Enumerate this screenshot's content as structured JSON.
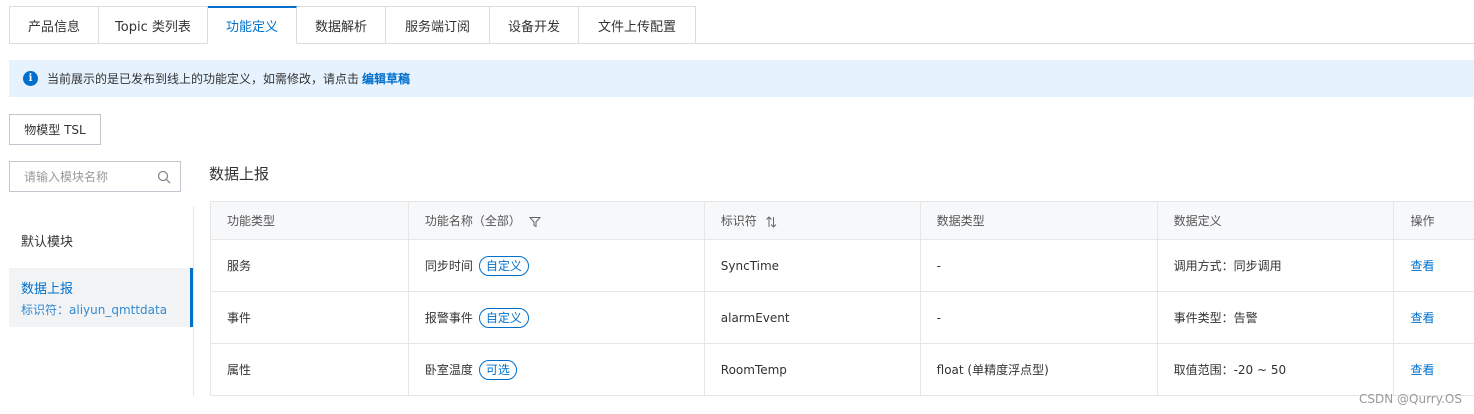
{
  "tabs": [
    {
      "label": "产品信息"
    },
    {
      "label": "Topic 类列表"
    },
    {
      "label": "功能定义",
      "active": true
    },
    {
      "label": "数据解析"
    },
    {
      "label": "服务端订阅"
    },
    {
      "label": "设备开发"
    },
    {
      "label": "文件上传配置"
    }
  ],
  "notice": {
    "text": "当前展示的是已发布到线上的功能定义，如需修改，请点击",
    "link": "编辑草稿"
  },
  "tsl_button": "物模型 TSL",
  "search": {
    "placeholder": "请输入模块名称"
  },
  "modules": [
    {
      "name": "默认模块"
    },
    {
      "name": "数据上报",
      "id_text": "标识符：aliyun_qmttdata"
    }
  ],
  "section_title": "数据上报",
  "table": {
    "headers": [
      "功能类型",
      "功能名称（全部）",
      "标识符",
      "数据类型",
      "数据定义",
      "操作"
    ],
    "rows": [
      {
        "type": "服务",
        "name": "同步时间",
        "tag": "自定义",
        "identifier": "SyncTime",
        "data_type": "-",
        "definition": "调用方式：同步调用",
        "action": "查看"
      },
      {
        "type": "事件",
        "name": "报警事件",
        "tag": "自定义",
        "identifier": "alarmEvent",
        "data_type": "-",
        "definition": "事件类型：告警",
        "action": "查看"
      },
      {
        "type": "属性",
        "name": "卧室温度",
        "tag": "可选",
        "identifier": "RoomTemp",
        "data_type": "float (单精度浮点型)",
        "definition": "取值范围：-20 ~ 50",
        "action": "查看"
      }
    ]
  },
  "watermark": "CSDN @Qurry.OS",
  "colors": {
    "accent": "#0070cc",
    "notice_bg": "#e6f3fe",
    "header_bg": "#f7f8fa"
  }
}
